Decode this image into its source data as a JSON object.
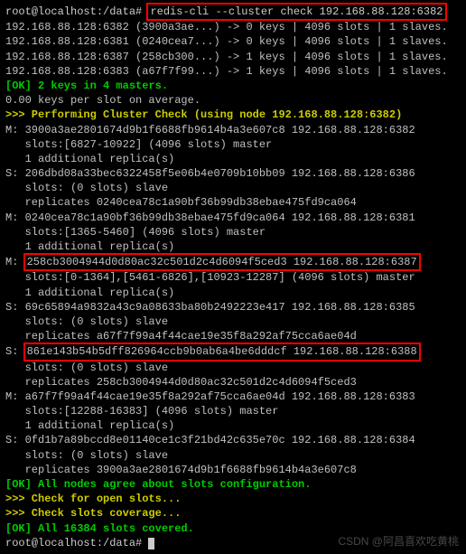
{
  "prompt": "root@localhost:/data# ",
  "command": "redis-cli --cluster check 192.168.88.128:6382",
  "summary": [
    "192.168.88.128:6382 (3900a3ae...) -> 0 keys | 4096 slots | 1 slaves.",
    "192.168.88.128:6381 (0240cea7...) -> 0 keys | 4096 slots | 1 slaves.",
    "192.168.88.128:6387 (258cb300...) -> 1 keys | 4096 slots | 1 slaves.",
    "192.168.88.128:6383 (a67f7f99...) -> 1 keys | 4096 slots | 1 slaves."
  ],
  "ok1": "[OK] 2 keys in 4 masters.",
  "avg": "0.00 keys per slot on average.",
  "perform": ">>> Performing Cluster Check (using node 192.168.88.128:6382)",
  "nodes": {
    "m1": {
      "l1": "M: 3900a3ae2801674d9b1f6688fb9614b4a3e607c8 192.168.88.128:6382",
      "l2": "   slots:[6827-10922] (4096 slots) master",
      "l3": "   1 additional replica(s)"
    },
    "s1": {
      "l1": "S: 206dbd08a33bec6322458f5e06b4e0709b10bb09 192.168.88.128:6386",
      "l2": "   slots: (0 slots) slave",
      "l3": "   replicates 0240cea78c1a90bf36b99db38ebae475fd9ca064"
    },
    "m2": {
      "l1": "M: 0240cea78c1a90bf36b99db38ebae475fd9ca064 192.168.88.128:6381",
      "l2": "   slots:[1365-5460] (4096 slots) master",
      "l3": "   1 additional replica(s)"
    },
    "m3": {
      "pre": "M: ",
      "box": "258cb3004944d0d80ac32c501d2c4d6094f5ced3 192.168.88.128:6387",
      "l2": "   slots:[0-1364],[5461-6826],[10923-12287] (4096 slots) master",
      "l3": "   1 additional replica(s)"
    },
    "s2": {
      "l1": "S: 69c65894a9832a43c9a08633ba80b2492223e417 192.168.88.128:6385",
      "l2": "   slots: (0 slots) slave",
      "l3": "   replicates a67f7f99a4f44cae19e35f8a292af75cca6ae04d"
    },
    "s3": {
      "pre": "S: ",
      "box": "861e143b54b5dff826964ccb9b0ab6a4be6dddcf 192.168.88.128:6388",
      "l2": "   slots: (0 slots) slave",
      "l3": "   replicates 258cb3004944d0d80ac32c501d2c4d6094f5ced3"
    },
    "m4": {
      "l1": "M: a67f7f99a4f44cae19e35f8a292af75cca6ae04d 192.168.88.128:6383",
      "l2": "   slots:[12288-16383] (4096 slots) master",
      "l3": "   1 additional replica(s)"
    },
    "s4": {
      "l1": "S: 0fd1b7a89bccd8e01140ce1c3f21bd42c635e70c 192.168.88.128:6384",
      "l2": "   slots: (0 slots) slave",
      "l3": "   replicates 3900a3ae2801674d9b1f6688fb9614b4a3e607c8"
    }
  },
  "ok2": "[OK] All nodes agree about slots configuration.",
  "check1": ">>> Check for open slots...",
  "check2": ">>> Check slots coverage...",
  "ok3": "[OK] All 16384 slots covered.",
  "prompt2": "root@localhost:/data# ",
  "watermark": "CSDN @阿昌喜欢吃黄桃"
}
